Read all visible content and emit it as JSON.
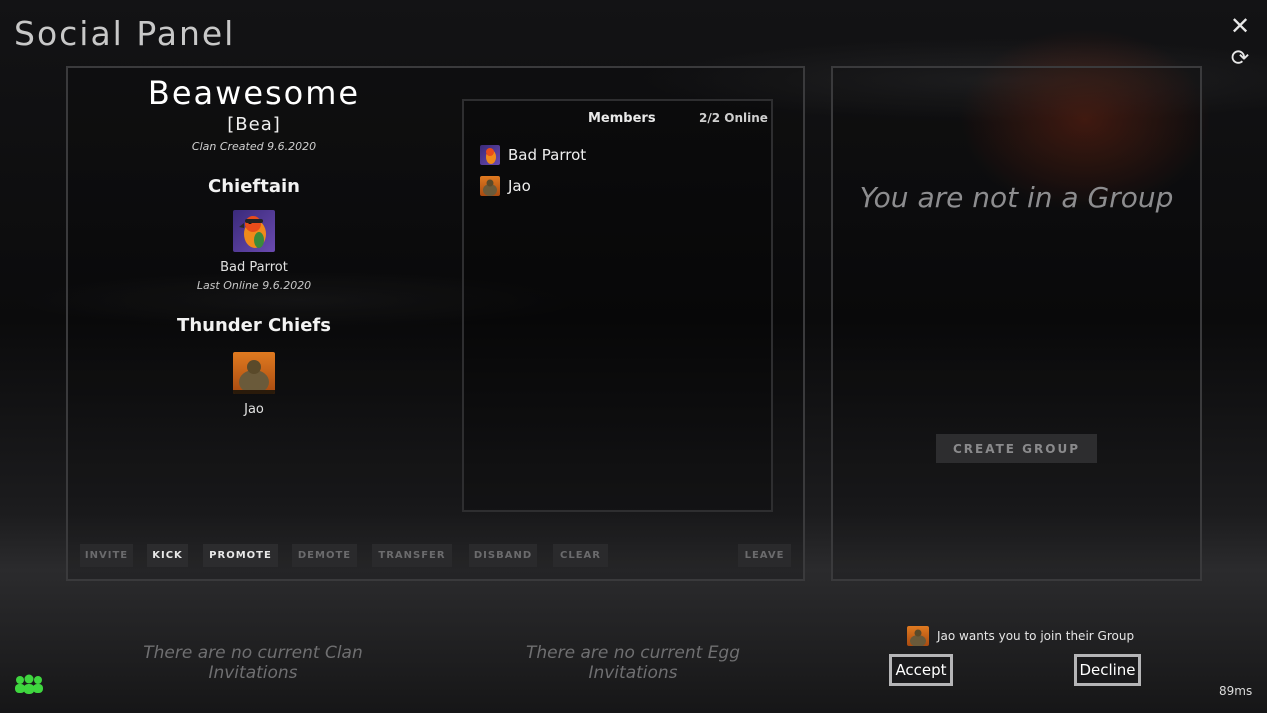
{
  "header": {
    "title": "Social Panel",
    "close_icon": "close-icon",
    "refresh_icon": "refresh-icon"
  },
  "clan": {
    "name": "Beawesome",
    "tag": "[Bea]",
    "created": "Clan Created 9.6.2020",
    "chieftain_heading": "Chieftain",
    "chieftain": {
      "name": "Bad Parrot",
      "last_online": "Last Online 9.6.2020"
    },
    "rank_heading": "Thunder Chiefs",
    "rank_member": {
      "name": "Jao"
    },
    "members": {
      "header": "Members",
      "online": "2/2 Online",
      "list": [
        {
          "name": "Bad Parrot"
        },
        {
          "name": "Jao"
        }
      ]
    },
    "actions": {
      "invite": "INVITE",
      "kick": "KICK",
      "promote": "PROMOTE",
      "demote": "DEMOTE",
      "transfer": "TRANSFER",
      "disband": "DISBAND",
      "clear": "CLEAR",
      "leave": "LEAVE"
    }
  },
  "group": {
    "status": "You are not in a Group",
    "create_label": "CREATE GROUP"
  },
  "invitations": {
    "clan_empty": "There are no current Clan Invitations",
    "egg_empty": "There are no current Egg Invitations"
  },
  "group_invite": {
    "message": "Jao wants you to join their Group",
    "accept_label": "Accept",
    "decline_label": "Decline"
  },
  "footer": {
    "social_icon": "people-icon",
    "ping": "89ms"
  },
  "colors": {
    "accent_green": "#3fd63f"
  }
}
